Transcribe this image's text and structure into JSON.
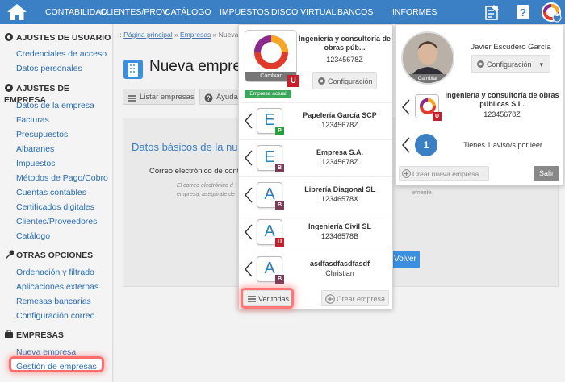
{
  "nav": [
    "CONTABILIDAD",
    "CLIENTES/PROV.",
    "CATÁLOGO",
    "IMPUESTOS",
    "DISCO VIRTUAL",
    "BANCOS",
    "INFORMES"
  ],
  "nav_badge": "1",
  "sidebar": {
    "s1": "AJUSTES DE USUARIO",
    "s1_items": [
      "Credenciales de acceso",
      "Datos personales"
    ],
    "s2": "AJUSTES DE EMPRESA",
    "s2_items": [
      "Datos de la empresa",
      "Facturas",
      "Presupuestos",
      "Albaranes",
      "Impuestos",
      "Métodos de Pago/Cobro",
      "Cuentas contables",
      "Certificados digitales",
      "Clientes/Proveedores",
      "Catálogo"
    ],
    "s3": "OTRAS OPCIONES",
    "s3_items": [
      "Ordenación y filtrado",
      "Aplicaciones externas",
      "Remesas bancarias",
      "Configuración correo"
    ],
    "s4": "EMPRESAS",
    "s4_items": [
      "Nueva empresa",
      "Gestión de empresas"
    ]
  },
  "main": {
    "bc_sep": "::",
    "bc1": "Página principal",
    "bc2": "Empresas",
    "bc3": "Nueva em",
    "title": "Nueva empres",
    "btn_list": "Listar empresas",
    "btn_help": "Ayuda",
    "card_title": "Datos básicos de la nu",
    "email_label": "Correo electrónico de cont",
    "help1": "El correo electrónico d",
    "help2": "empresa, asegúrate de",
    "help3": "emente.",
    "volver": "Volver"
  },
  "companies": {
    "current": {
      "name": "Ingeniería y consultoría de obras púb...",
      "id": "12345678Z",
      "cambiar": "Cambiar",
      "badge": "U",
      "actual": "Empresa actual",
      "config": "Configuración"
    },
    "list": [
      {
        "letter": "E",
        "badge": "P",
        "name": "Papelería García SCP",
        "id": "12345678Z",
        "color": "#27a23a"
      },
      {
        "letter": "E",
        "badge": "B",
        "name": "Empresa S.A.",
        "id": "12345678Z",
        "color": "#7a3b57"
      },
      {
        "letter": "A",
        "badge": "B",
        "name": "Librería Diagonal SL",
        "id": "12346578X",
        "color": "#7a3b57"
      },
      {
        "letter": "A",
        "badge": "U",
        "name": "Ingeniería Civil SL",
        "id": "12346578B",
        "color": "#c4202c"
      },
      {
        "letter": "A",
        "badge": "B",
        "name": "asdfasdfasdfasdf",
        "id": "Christian",
        "color": "#7a3b57"
      }
    ],
    "ver_todas": "Ver todas",
    "crear": "Crear empresa"
  },
  "user": {
    "name": "Javier Escudero García",
    "config": "Configuración",
    "cambiar": "Cambiar",
    "company": "Ingeniería y consultoría de obras públicas S.L.",
    "company_id": "12345678Z",
    "badge": "U",
    "notif_count": "1",
    "notif_text": "Tienes 1 aviso/s por leer",
    "crear": "Crear nueva empresa",
    "salir": "Salir"
  }
}
